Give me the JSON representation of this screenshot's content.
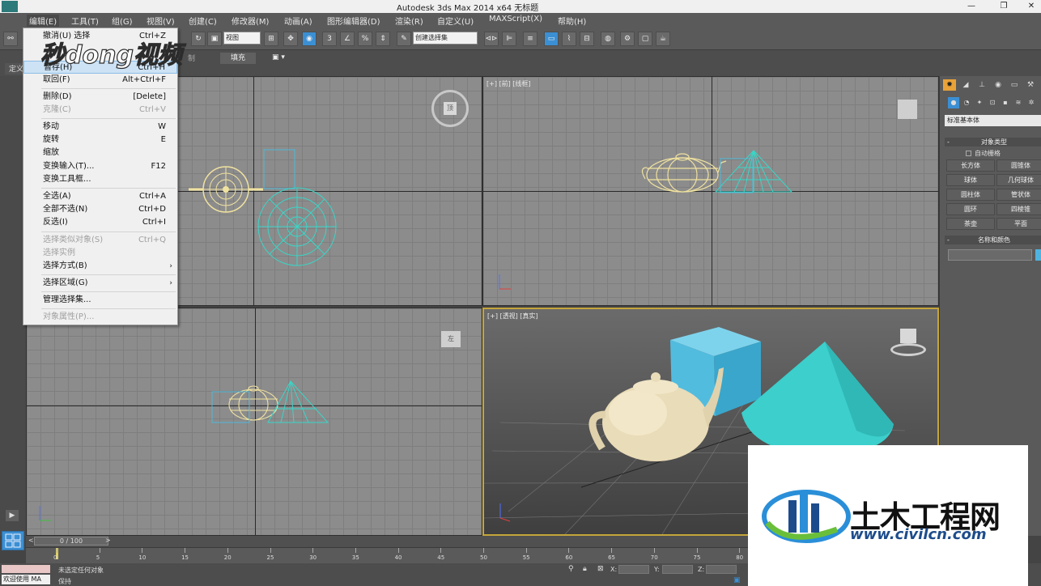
{
  "titlebar": {
    "title": "Autodesk 3ds Max  2014 x64     无标题",
    "min": "—",
    "restore": "❐",
    "close": "✕"
  },
  "menubar": {
    "items": [
      "编辑(E)",
      "工具(T)",
      "组(G)",
      "视图(V)",
      "创建(C)",
      "修改器(M)",
      "动画(A)",
      "图形编辑器(D)",
      "渲染(R)",
      "自定义(U)",
      "MAXScript(X)",
      "帮助(H)"
    ]
  },
  "toolbar": {
    "view_select": "视图",
    "selection_set": "创建选择集"
  },
  "ribbon": {
    "left_tab": "定义",
    "fake_tab": "制",
    "fill_tab": "填充"
  },
  "editmenu": {
    "items": [
      {
        "label": "撤消(U) 选择",
        "shortcut": "Ctrl+Z",
        "disabled": false
      },
      {
        "label": "暂存(H)",
        "shortcut": "Ctrl+H",
        "disabled": false,
        "highlight": true
      },
      {
        "label": "取回(F)",
        "shortcut": "Alt+Ctrl+F",
        "disabled": false
      },
      {
        "label": "删除(D)",
        "shortcut": "[Delete]",
        "disabled": false
      },
      {
        "label": "克隆(C)",
        "shortcut": "Ctrl+V",
        "disabled": true
      },
      {
        "label": "移动",
        "shortcut": "W",
        "disabled": false
      },
      {
        "label": "旋转",
        "shortcut": "E",
        "disabled": false
      },
      {
        "label": "缩放",
        "shortcut": "",
        "disabled": false
      },
      {
        "label": "变换输入(T)...",
        "shortcut": "F12",
        "disabled": false
      },
      {
        "label": "变换工具框...",
        "shortcut": "",
        "disabled": false
      },
      {
        "label": "全选(A)",
        "shortcut": "Ctrl+A",
        "disabled": false
      },
      {
        "label": "全部不选(N)",
        "shortcut": "Ctrl+D",
        "disabled": false
      },
      {
        "label": "反选(I)",
        "shortcut": "Ctrl+I",
        "disabled": false
      },
      {
        "label": "选择类似对象(S)",
        "shortcut": "Ctrl+Q",
        "disabled": true
      },
      {
        "label": "选择实例",
        "shortcut": "",
        "disabled": true
      },
      {
        "label": "选择方式(B)",
        "shortcut": "›",
        "disabled": false
      },
      {
        "label": "选择区域(G)",
        "shortcut": "›",
        "disabled": false
      },
      {
        "label": "管理选择集...",
        "shortcut": "",
        "disabled": false
      },
      {
        "label": "对象属性(P)...",
        "shortcut": "",
        "disabled": true
      }
    ]
  },
  "viewports": {
    "front_label": "[+] [前] [线框]",
    "persp_label": "[+] [透视] [真实]"
  },
  "viewcube": {
    "top_face": "顶",
    "left_face": "左"
  },
  "cmdpanel": {
    "category": "标准基本体",
    "object_type_title": "对象类型",
    "autogrid": "自动栅格",
    "buttons": [
      "长方体",
      "圆锥体",
      "球体",
      "几何球体",
      "圆柱体",
      "管状体",
      "圆环",
      "四棱锥",
      "茶壶",
      "平面"
    ],
    "name_color_title": "名称和颜色",
    "color": "#4fb3e0"
  },
  "timeline": {
    "frame": "0 / 100",
    "ticks": [
      "0",
      "5",
      "10",
      "15",
      "20",
      "25",
      "30",
      "35",
      "40",
      "45",
      "50",
      "55",
      "60",
      "65",
      "70",
      "75",
      "80"
    ]
  },
  "statusbar": {
    "welcome": "欢迎使用 MA",
    "message": "未选定任何对象",
    "prompt": "保持",
    "x_label": "X:",
    "y_label": "Y:",
    "z_label": "Z:"
  },
  "watermarks": {
    "top": "秒dong视频",
    "brand_cn": "土木工程网",
    "brand_url": "www.civilcn.com"
  },
  "colors": {
    "wire_teapot": "#f0e2a0",
    "wire_cyan": "#39d6c8",
    "box": "#4fb8d8",
    "cone": "#3ad0cd",
    "teapot_solid": "#e9dcb8",
    "accent": "#3b8fd3"
  }
}
